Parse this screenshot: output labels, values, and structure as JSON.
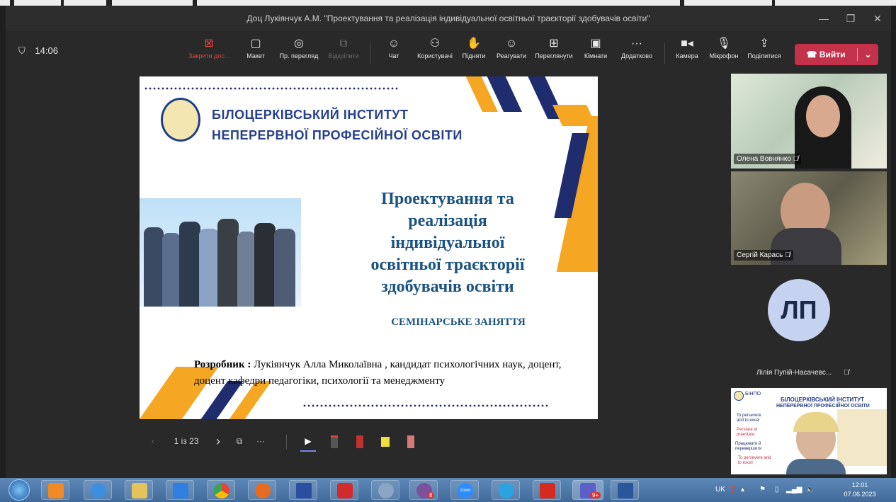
{
  "window": {
    "title": "Доц Лукіянчук А.М. \"Проектування та реалізація індивідуальної освітньої траєкторії здобувачів освіти\"",
    "minimize": "—",
    "maximize": "❐",
    "close": "✕"
  },
  "meeting": {
    "time": "14:06"
  },
  "toolbar": {
    "stop_share": "Закрити дос...",
    "layout": "Макет",
    "preview": "Пр. перегляд",
    "pop_out": "Відкріпити",
    "chat": "Чат",
    "people": "Користувачі",
    "raise": "Підняти",
    "react": "Реагувати",
    "view": "Переглянути",
    "rooms": "Кімнати",
    "more": "Додатково",
    "camera": "Камера",
    "mic": "Мікрофон",
    "share": "Поділитися",
    "leave": "Вийти"
  },
  "slide": {
    "institute_line1": "БІЛОЦЕРКІВСЬКИЙ ІНСТИТУТ",
    "institute_line2": "НЕПЕРЕРВНОЇ ПРОФЕСІЙНОЇ ОСВІТИ",
    "title_line1": "Проектування та",
    "title_line2": "реалізація",
    "title_line3": "індивідуальної",
    "title_line4": "освітньої траєкторії",
    "title_line5": "здобувачів освіти",
    "seminar": "СЕМІНАРСЬКЕ ЗАНЯТТЯ",
    "author_label": "Розробник :",
    "author_text": " Лукіянчук Алла Миколаївна , кандидат психологічних наук, доцент,  доцент кафедри педагогіки, психології та менеджменту"
  },
  "presenter": {
    "page": "1 із 23"
  },
  "participants": [
    {
      "name": "Олена Вовнянко"
    },
    {
      "name": "Сергій Карась"
    },
    {
      "name": "Лілія Пупій-Насачевс...",
      "initials": "ЛП"
    }
  ],
  "thumbnail": {
    "brand": "БІНПО",
    "line1": "БІЛОЦЕРКІВСЬКИЙ ІНСТИТУТ",
    "line2": "НЕПЕРЕРВНОЇ ПРОФЕСІЙНОЇ ОСВІТИ",
    "motto1": "To persevere and to excel",
    "motto2": "Perstare et praestare",
    "motto3": "Працювати й перевершити",
    "motto4": "To persevere and to excel"
  },
  "taskbar": {
    "language": "UK",
    "clock_time": "12:01",
    "clock_date": "07.06.2023",
    "viber_badge": "8",
    "teams_badge": "9+",
    "zoom_label": "zoom"
  },
  "colors": {
    "leave_red": "#c4314b",
    "slide_blue": "#1b5380",
    "stripe_orange": "#f5a623",
    "stripe_navy": "#1f2c6e"
  }
}
